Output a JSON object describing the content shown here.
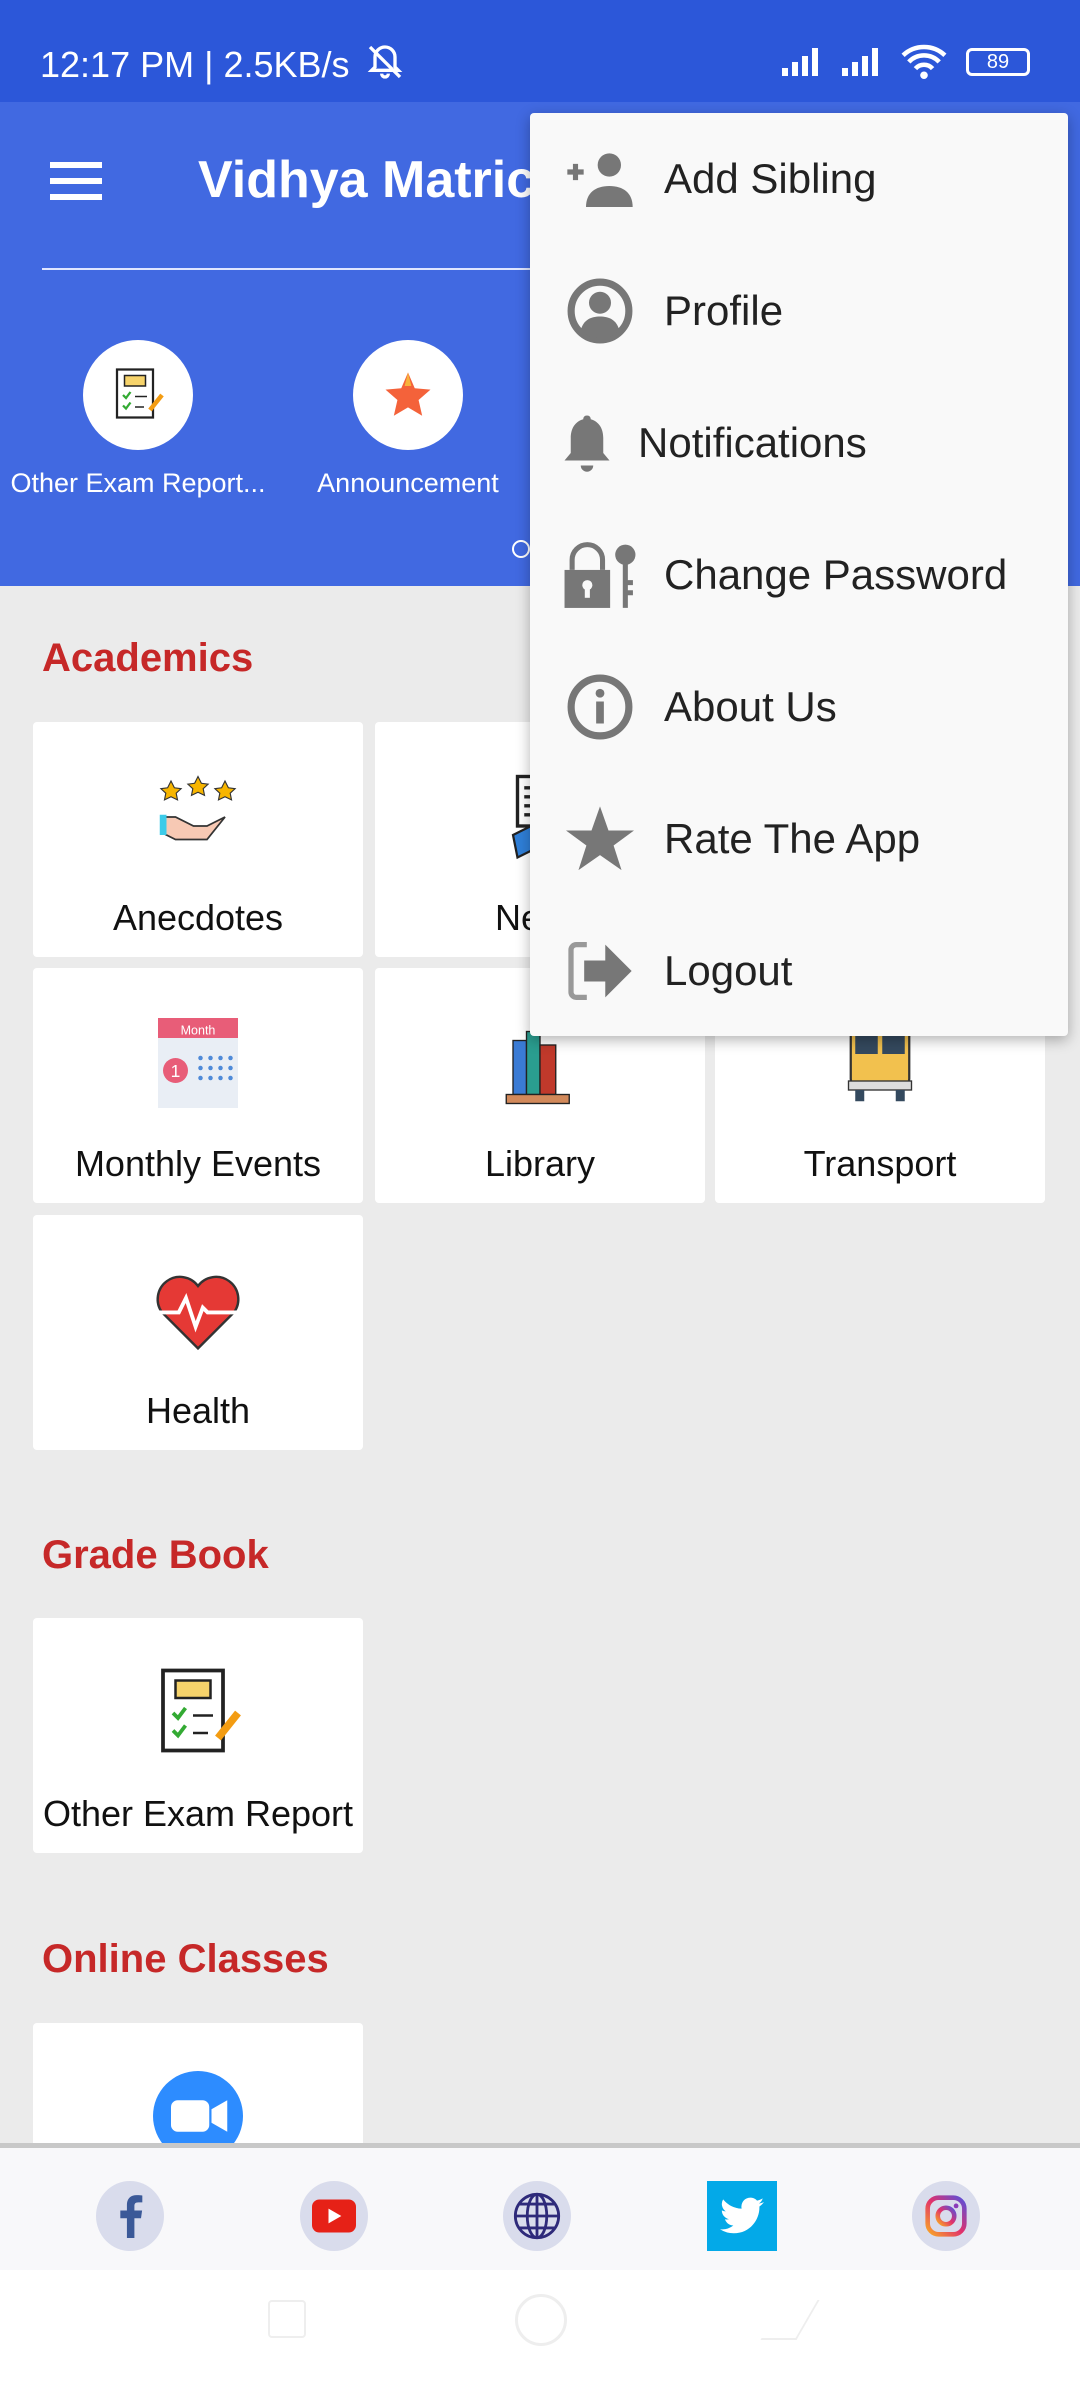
{
  "status_bar": {
    "time": "12:17 PM | 2.5KB/s",
    "battery": "89"
  },
  "header": {
    "title": "Vidhya Matric",
    "quick_links": [
      {
        "label": "Other Exam Report..."
      },
      {
        "label": "Announcement"
      }
    ]
  },
  "sections": [
    {
      "title": "Academics",
      "cards": [
        {
          "label": "Anecdotes"
        },
        {
          "label": "News"
        },
        {
          "label": ""
        },
        {
          "label": "Monthly Events"
        },
        {
          "label": "Library"
        },
        {
          "label": "Transport"
        },
        {
          "label": "Health"
        }
      ]
    },
    {
      "title": "Grade Book",
      "cards": [
        {
          "label": "Other Exam Report"
        }
      ]
    },
    {
      "title": "Online Classes",
      "cards": [
        {
          "label": ""
        }
      ]
    }
  ],
  "calendar_icon_text": "Month",
  "menu": {
    "items": [
      {
        "label": "Add Sibling",
        "icon": "add-person-icon"
      },
      {
        "label": "Profile",
        "icon": "profile-icon"
      },
      {
        "label": "Notifications",
        "icon": "bell-icon"
      },
      {
        "label": "Change Password",
        "icon": "lock-key-icon"
      },
      {
        "label": "About Us",
        "icon": "info-icon"
      },
      {
        "label": "Rate The App",
        "icon": "star-icon"
      },
      {
        "label": "Logout",
        "icon": "logout-icon"
      }
    ]
  },
  "social": [
    "facebook-icon",
    "youtube-icon",
    "website-globe-icon",
    "twitter-icon",
    "instagram-icon"
  ],
  "colors": {
    "status_bar": "#2c57d9",
    "header": "#4169e1",
    "section_title": "#c62828",
    "twitter": "#03a9e8"
  }
}
